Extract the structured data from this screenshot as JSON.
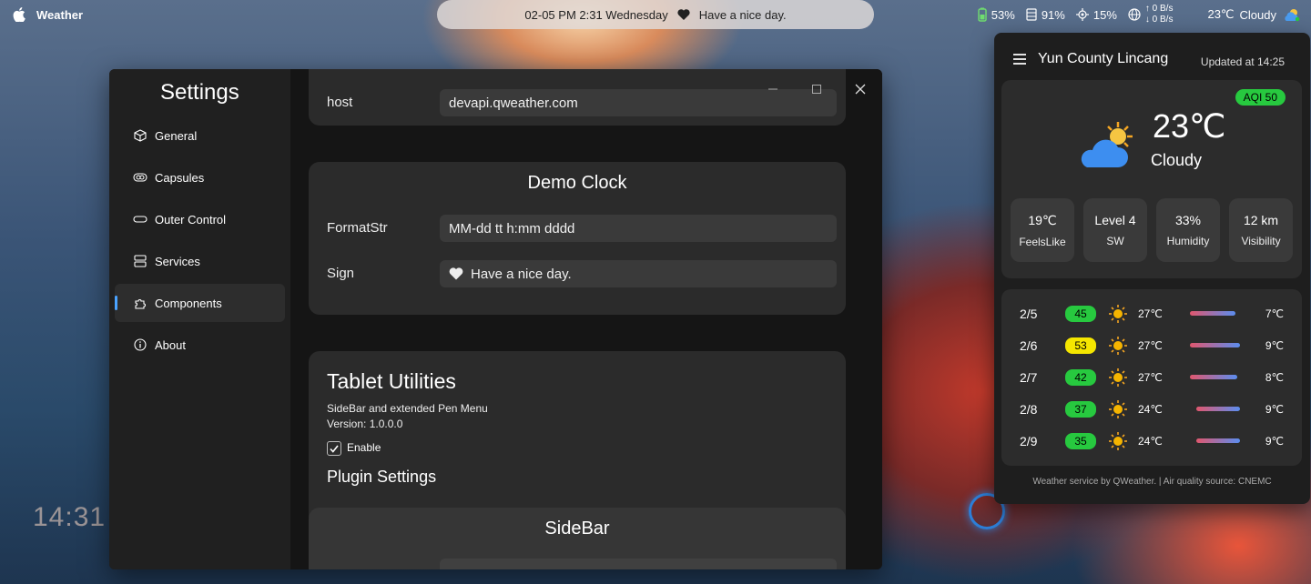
{
  "menubar": {
    "app_name": "Weather",
    "capsule_datetime": "02-05 PM 2:31 Wednesday",
    "capsule_sign": "Have a nice day.",
    "battery": "53%",
    "memory": "91%",
    "cpu": "15%",
    "net_up": "0 B/s",
    "net_down": "0 B/s",
    "weather_temp": "23℃",
    "weather_cond": "Cloudy"
  },
  "desktop": {
    "clock": "14:31"
  },
  "settings": {
    "title": "Settings",
    "nav": [
      {
        "label": "General",
        "icon": "cube-icon"
      },
      {
        "label": "Capsules",
        "icon": "capsule-icon"
      },
      {
        "label": "Outer Control",
        "icon": "pill-icon"
      },
      {
        "label": "Services",
        "icon": "server-icon"
      },
      {
        "label": "Components",
        "icon": "puzzle-icon",
        "active": true
      },
      {
        "label": "About",
        "icon": "info-icon"
      }
    ],
    "host_card": {
      "label": "host",
      "value": "devapi.qweather.com"
    },
    "demo_clock": {
      "title": "Demo Clock",
      "format_label": "FormatStr",
      "format_value": "MM-dd tt h:mm dddd",
      "sign_label": "Sign",
      "sign_value": "Have a nice day."
    },
    "tablet": {
      "title": "Tablet Utilities",
      "desc": "SideBar and extended Pen Menu",
      "version": "Version: 1.0.0.0",
      "enable_label": "Enable",
      "enabled": true,
      "plugin_settings": "Plugin Settings",
      "sidebar_title": "SideBar"
    }
  },
  "weather": {
    "city": "Yun County Lincang",
    "updated": "Updated at 14:25",
    "aqi": "AQI 50",
    "temp": "23℃",
    "condition": "Cloudy",
    "metrics": [
      {
        "value": "19℃",
        "label": "FeelsLike"
      },
      {
        "value": "Level 4",
        "label": "SW"
      },
      {
        "value": "33%",
        "label": "Humidity"
      },
      {
        "value": "12 km",
        "label": "Visibility"
      }
    ],
    "forecast": [
      {
        "date": "2/5",
        "aqi": "45",
        "aqi_color": "#27c93f",
        "high": "27℃",
        "low": "7℃"
      },
      {
        "date": "2/6",
        "aqi": "53",
        "aqi_color": "#f5e600",
        "high": "27℃",
        "low": "9℃"
      },
      {
        "date": "2/7",
        "aqi": "42",
        "aqi_color": "#27c93f",
        "high": "27℃",
        "low": "8℃"
      },
      {
        "date": "2/8",
        "aqi": "37",
        "aqi_color": "#27c93f",
        "high": "24℃",
        "low": "9℃"
      },
      {
        "date": "2/9",
        "aqi": "35",
        "aqi_color": "#27c93f",
        "high": "24℃",
        "low": "9℃"
      }
    ],
    "footer": "Weather service by QWeather. | Air quality source: CNEMC"
  }
}
